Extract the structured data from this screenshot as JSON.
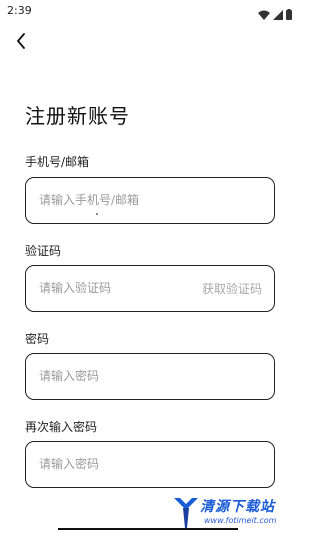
{
  "status_bar": {
    "time": "2:39"
  },
  "header": {
    "back_icon": "chevron-left-icon"
  },
  "page": {
    "title": "注册新账号"
  },
  "form": {
    "account": {
      "label": "手机号/邮箱",
      "placeholder": "请输入手机号/邮箱"
    },
    "code": {
      "label": "验证码",
      "placeholder": "请输入验证码",
      "action": "获取验证码"
    },
    "password": {
      "label": "密码",
      "placeholder": "请输入密码"
    },
    "confirm_password": {
      "label": "再次输入密码",
      "placeholder": "请输入密码"
    }
  },
  "watermark": {
    "title": "清源下载站",
    "url": "www.fotimeit.com"
  },
  "colors": {
    "border": "#222222",
    "placeholder": "#9a9a9a",
    "link_disabled": "#a8a8a8",
    "watermark_blue": "#1a5bd6"
  }
}
